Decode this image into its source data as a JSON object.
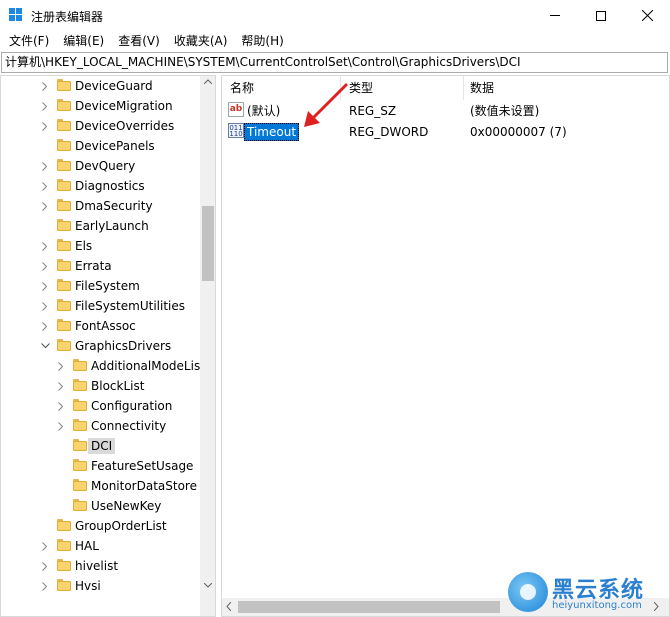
{
  "window": {
    "title": "注册表编辑器"
  },
  "menu": [
    "文件(F)",
    "编辑(E)",
    "查看(V)",
    "收藏夹(A)",
    "帮助(H)"
  ],
  "address": "计算机\\HKEY_LOCAL_MACHINE\\SYSTEM\\CurrentControlSet\\Control\\GraphicsDrivers\\DCI",
  "tree": {
    "nodes": [
      {
        "label": "DeviceGuard",
        "expander": "collapsed"
      },
      {
        "label": "DeviceMigration",
        "expander": "collapsed"
      },
      {
        "label": "DeviceOverrides",
        "expander": "collapsed"
      },
      {
        "label": "DevicePanels",
        "expander": "none"
      },
      {
        "label": "DevQuery",
        "expander": "collapsed"
      },
      {
        "label": "Diagnostics",
        "expander": "collapsed"
      },
      {
        "label": "DmaSecurity",
        "expander": "collapsed"
      },
      {
        "label": "EarlyLaunch",
        "expander": "none"
      },
      {
        "label": "Els",
        "expander": "collapsed"
      },
      {
        "label": "Errata",
        "expander": "collapsed"
      },
      {
        "label": "FileSystem",
        "expander": "collapsed"
      },
      {
        "label": "FileSystemUtilities",
        "expander": "collapsed"
      },
      {
        "label": "FontAssoc",
        "expander": "collapsed"
      },
      {
        "label": "GraphicsDrivers",
        "expander": "expanded"
      },
      {
        "label": "AdditionalModeLis",
        "expander": "collapsed"
      },
      {
        "label": "BlockList",
        "expander": "collapsed"
      },
      {
        "label": "Configuration",
        "expander": "collapsed"
      },
      {
        "label": "Connectivity",
        "expander": "collapsed"
      },
      {
        "label": "DCI",
        "expander": "none"
      },
      {
        "label": "FeatureSetUsage",
        "expander": "none"
      },
      {
        "label": "MonitorDataStore",
        "expander": "none"
      },
      {
        "label": "UseNewKey",
        "expander": "none"
      },
      {
        "label": "GroupOrderList",
        "expander": "none"
      },
      {
        "label": "HAL",
        "expander": "collapsed"
      },
      {
        "label": "hivelist",
        "expander": "collapsed"
      },
      {
        "label": "Hvsi",
        "expander": "collapsed"
      }
    ]
  },
  "list": {
    "headers": {
      "name": "名称",
      "type": "类型",
      "data": "数据"
    },
    "rows": [
      {
        "name": "(默认)",
        "type": "REG_SZ",
        "data": "(数值未设置)",
        "icon": "string-value-icon"
      },
      {
        "name": "Timeout",
        "type": "REG_DWORD",
        "data": "0x00000007 (7)",
        "icon": "binary-value-icon"
      }
    ]
  },
  "watermark": {
    "title": "黑云系统",
    "url": "heiyunxitong.com"
  },
  "colors": {
    "selection": "#0078d7",
    "annotation_arrow": "#e02020",
    "folder": "#fbd56c"
  }
}
